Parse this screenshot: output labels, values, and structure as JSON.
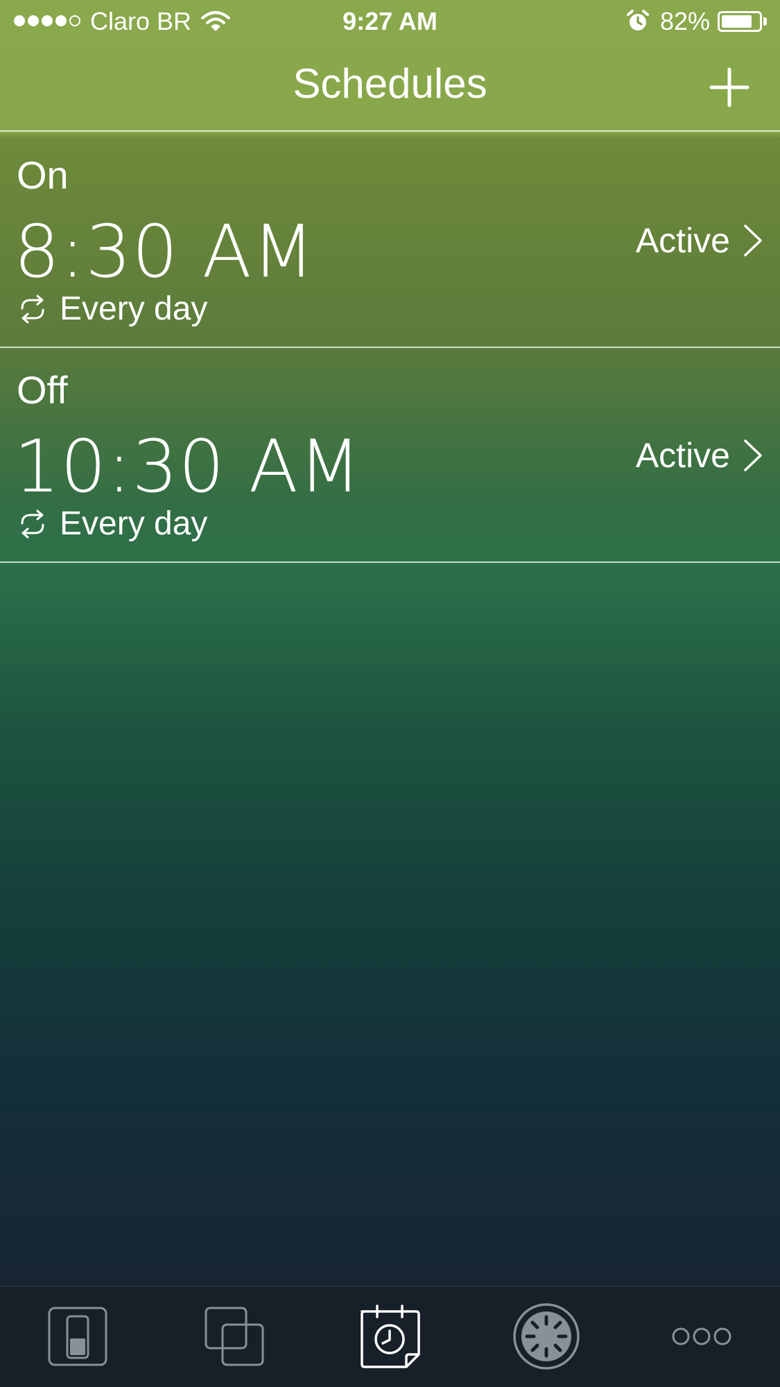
{
  "status_bar": {
    "carrier": "Claro BR",
    "time": "9:27 AM",
    "battery_percent": "82%",
    "battery_level": 0.82,
    "signal_bars_filled": 4,
    "signal_bars_total": 5,
    "icons": [
      "signal-dots-icon",
      "wifi-icon",
      "alarm-clock-icon",
      "battery-icon"
    ]
  },
  "nav": {
    "title": "Schedules",
    "add_icon": "plus-icon"
  },
  "schedules": [
    {
      "state": "On",
      "time": "8:30 AM",
      "repeat": "Every day",
      "status": "Active"
    },
    {
      "state": "Off",
      "time": "10:30 AM",
      "repeat": "Every day",
      "status": "Active"
    }
  ],
  "tabs": [
    {
      "icon": "switch-icon",
      "selected": false
    },
    {
      "icon": "groups-icon",
      "selected": false
    },
    {
      "icon": "schedule-calendar-icon",
      "selected": true
    },
    {
      "icon": "dimmer-dial-icon",
      "selected": false
    },
    {
      "icon": "more-icon",
      "selected": false
    }
  ],
  "colors": {
    "header_green": "#8aa84c",
    "background_bottom": "#171f28",
    "text": "#ffffff",
    "tab_inactive": "#8a9097"
  }
}
